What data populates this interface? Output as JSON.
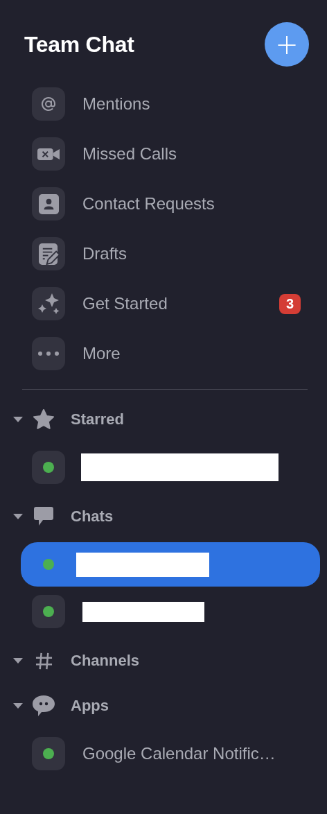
{
  "header": {
    "title": "Team Chat",
    "add_button": "+"
  },
  "menu": [
    {
      "kind": "at",
      "label": "Mentions"
    },
    {
      "kind": "video",
      "label": "Missed Calls"
    },
    {
      "kind": "contact",
      "label": "Contact Requests"
    },
    {
      "kind": "draft",
      "label": "Drafts"
    },
    {
      "kind": "sparkle",
      "label": "Get Started",
      "badge": "3"
    },
    {
      "kind": "dots",
      "label": "More"
    }
  ],
  "sections": [
    {
      "kind": "star",
      "title": "Starred",
      "expanded": true,
      "items": [
        {
          "kind": "redacted",
          "selected": false
        }
      ]
    },
    {
      "kind": "bubble",
      "title": "Chats",
      "expanded": true,
      "items": [
        {
          "kind": "redacted",
          "selected": true
        },
        {
          "kind": "redacted",
          "selected": false
        }
      ]
    },
    {
      "kind": "hash",
      "title": "Channels",
      "expanded": true
    },
    {
      "kind": "app",
      "title": "Apps",
      "expanded": true,
      "items": [
        {
          "kind": "named",
          "label": "Google Calendar Notific…",
          "selected": false
        }
      ]
    }
  ]
}
